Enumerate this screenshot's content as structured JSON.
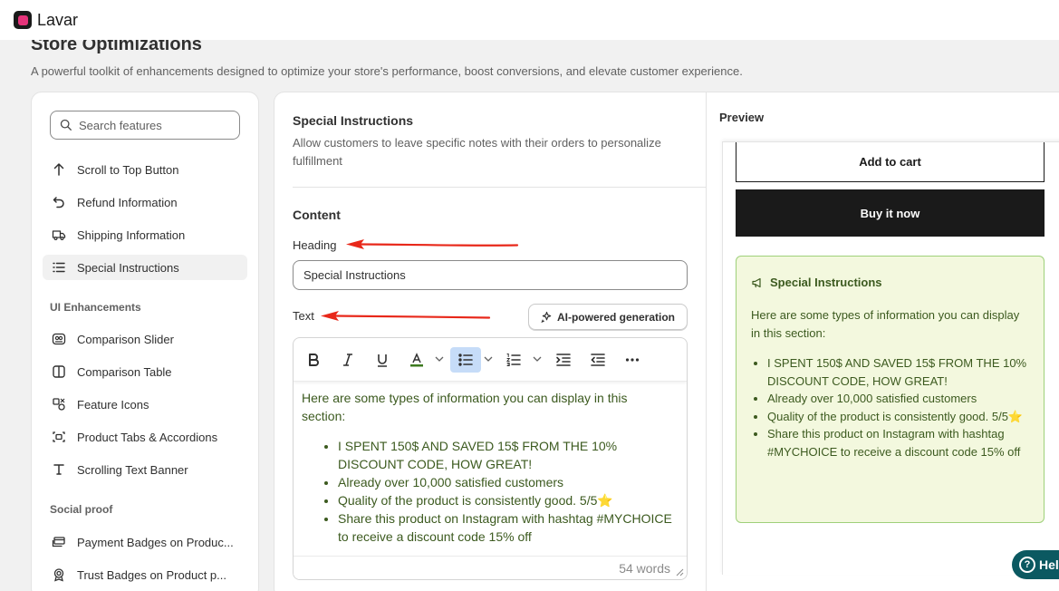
{
  "app": {
    "name": "Lavar"
  },
  "page": {
    "title": "Store Optimizations",
    "subtitle": "A powerful toolkit of enhancements designed to optimize your store's performance, boost conversions, and elevate customer experience."
  },
  "sidebar": {
    "search_placeholder": "Search features",
    "items_top": [
      {
        "label": "Scroll to Top Button",
        "icon": "arrow-up-icon"
      },
      {
        "label": "Refund Information",
        "icon": "undo-icon"
      },
      {
        "label": "Shipping Information",
        "icon": "truck-icon"
      },
      {
        "label": "Special Instructions",
        "icon": "list-icon",
        "active": true
      }
    ],
    "ui_section_label": "UI Enhancements",
    "ui_items": [
      {
        "label": "Comparison Slider",
        "icon": "image-compare-icon"
      },
      {
        "label": "Comparison Table",
        "icon": "split-panel-icon"
      },
      {
        "label": "Feature Icons",
        "icon": "shapes-icon"
      },
      {
        "label": "Product Tabs & Accordions",
        "icon": "tabs-icon"
      },
      {
        "label": "Scrolling Text Banner",
        "icon": "text-icon"
      }
    ],
    "social_section_label": "Social proof",
    "social_items": [
      {
        "label": "Payment Badges on Produc...",
        "icon": "credit-card-icon"
      },
      {
        "label": "Trust Badges on Product p...",
        "icon": "badge-icon"
      }
    ]
  },
  "feature": {
    "title": "Special Instructions",
    "description": "Allow customers to leave specific notes with their orders to personalize fulfillment",
    "content_label": "Content",
    "heading_label": "Heading",
    "heading_value": "Special Instructions",
    "text_label": "Text",
    "ai_button_label": "AI-powered generation",
    "editor": {
      "intro": "Here are some types of information you can display in this section:",
      "bullets": [
        "I SPENT 150$ AND SAVED 15$ FROM THE 10% DISCOUNT CODE, HOW GREAT!",
        "Already over 10,000 satisfied customers",
        "Quality of the product is consistently good. 5/5⭐",
        "Share this product on Instagram with hashtag #MYCHOICE to receive a discount code 15% off"
      ],
      "word_count": "54 words"
    }
  },
  "preview": {
    "title": "Preview",
    "add_to_cart": "Add to cart",
    "buy_now": "Buy it now",
    "box_heading": "Special Instructions",
    "box_intro": "Here are some types of information you can display in this section:",
    "box_bullets": [
      "I SPENT 150$ AND SAVED 15$ FROM THE 10% DISCOUNT CODE, HOW GREAT!",
      "Already over 10,000 satisfied customers",
      "Quality of the product is consistently good. 5/5⭐",
      "Share this product on Instagram with hashtag #MYCHOICE to receive a discount code 15% off"
    ]
  },
  "help": {
    "label": "Hel"
  },
  "colors": {
    "accent_green_text": "#3c5a1f",
    "preview_box_bg": "#f3f8de",
    "preview_box_border": "#9ed07a",
    "annotation_arrow": "#e8281a",
    "help_button": "#0b5961"
  }
}
